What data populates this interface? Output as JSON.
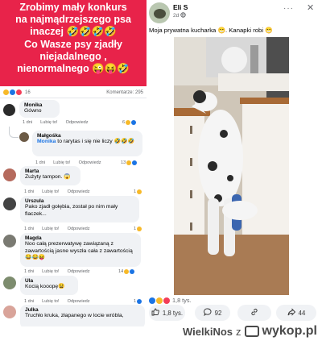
{
  "left": {
    "banner": {
      "lines": [
        "Zrobimy mały konkurs",
        "na najmądrzejszego psa",
        "inaczej 🤣🤣🤣🤣",
        "Co Wasze psy zjadły",
        "niejadalnego ,",
        "nienormalnego 😜😝🤣"
      ]
    },
    "stats": {
      "count": "16",
      "comments": "Komentarze: 295"
    },
    "actions": {
      "day": "1 dni",
      "like": "Lubię to!",
      "reply": "Odpowiedz"
    },
    "comments": [
      {
        "name": "Monika",
        "text": "Gówno",
        "reactions": "6",
        "avatar_color": "#2b2b2b"
      },
      {
        "name": "Małgośka",
        "mention": "Monika",
        "text": " to rarytas i się nie liczy 🤣🤣🤣",
        "reactions": "13",
        "avatar_color": "#6b5a45"
      },
      {
        "name": "Marta",
        "text": "Zużyty tampon. 😱",
        "reactions": "1",
        "avatar_color": "#b56a5d"
      },
      {
        "name": "Urszula",
        "text": "Pako zjadł gołębia, został po nim mały flaczek...",
        "reactions": "1",
        "avatar_color": "#444444"
      },
      {
        "name": "Magda",
        "text": "Noo całą prezerwatywę zawiązaną z zawartością jasne wyszła cała z zawartością 😂😂😝",
        "reactions": "14",
        "avatar_color": "#7a7a72"
      },
      {
        "name": "Ula",
        "text": "Kocią kooopę😫",
        "reactions": "1",
        "avatar_color": "#7d8c6e"
      },
      {
        "name": "Julka",
        "text": "Truchło kruka, złapanego w locie wróbla,",
        "reactions": "",
        "avatar_color": "#d9a49a"
      }
    ]
  },
  "right": {
    "name": "Eli S",
    "time": "2d",
    "more": "···",
    "close": "✕",
    "caption": "Moja prywatna kucharka 😁. Kanapki robi 😁",
    "reactions": "1,8 tys.",
    "actions": {
      "likes": "1,8 tys.",
      "comments": "92",
      "shares": "44"
    }
  },
  "watermark": {
    "user": "WielkiNos",
    "z": "z",
    "site": "wykop.pl"
  },
  "colors": {
    "banner": "#e8234a",
    "like_blue": "#1b74e4",
    "haha_yellow": "#f7b928",
    "love_red": "#f33e58"
  }
}
